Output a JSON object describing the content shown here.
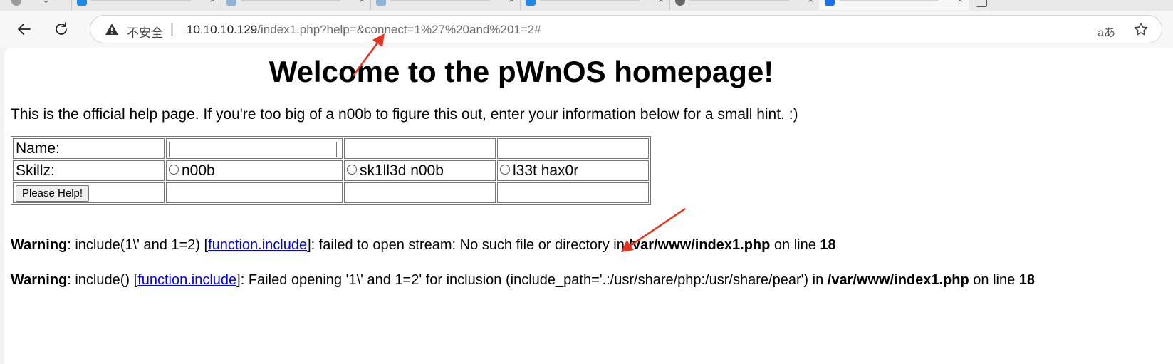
{
  "browser": {
    "security_label": "不安全",
    "separator": "|",
    "url_host": "10.10.10.129",
    "url_path": "/index1.php?help=&connect=1%27%20and%201=2#",
    "read_aloud_label": "aあ",
    "accent_color": "#0067c0"
  },
  "page": {
    "heading": "Welcome to the pWnOS homepage!",
    "intro": "This is the official help page. If you're too big of a n00b to figure this out, enter your information below for a small hint. :)",
    "form": {
      "name_label": "Name:",
      "name_value": "",
      "skill_label": "Skillz:",
      "skill_options": [
        "n00b",
        "sk1ll3d n00b",
        "l33t hax0r"
      ],
      "submit_label": "Please Help!"
    },
    "warnings": [
      {
        "label": "Warning",
        "text1": ": include(1\\' and 1=2) [",
        "link": "function.include",
        "text2": "]: failed to open stream: No such file or directory in ",
        "file": "/var/www/index1.php",
        "text3": " on line ",
        "line": "18"
      },
      {
        "label": "Warning",
        "text1": ": include() [",
        "link": "function.include",
        "text2": "]: Failed opening '1\\' and 1=2' for inclusion (include_path='.:/usr/share/php:/usr/share/pear') in ",
        "file": "/var/www/index1.php",
        "text3": " on line ",
        "line": "18"
      }
    ],
    "annotation_color": "#e8321e"
  }
}
